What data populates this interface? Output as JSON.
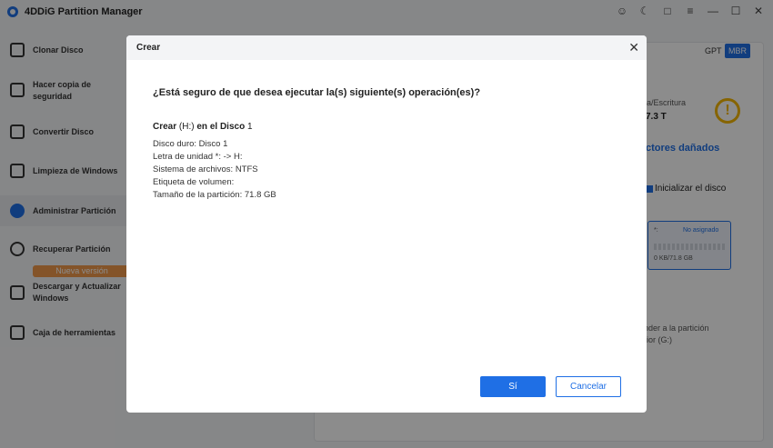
{
  "app": {
    "title": "4DDiG Partition Manager"
  },
  "window_icons": [
    "user-icon",
    "moon-icon",
    "feedback-icon",
    "menu-icon",
    "minimize-icon",
    "maximize-icon",
    "close-icon"
  ],
  "sidebar": {
    "items": [
      {
        "label": "Clonar Disco",
        "icon": "clone-disk-icon"
      },
      {
        "label": "Hacer copia de seguridad",
        "icon": "backup-icon"
      },
      {
        "label": "Convertir Disco",
        "icon": "convert-disk-icon"
      },
      {
        "label": "Limpieza de Windows",
        "icon": "broom-icon"
      },
      {
        "label": "Administrar Partición",
        "icon": "pie-chart-icon",
        "active": true
      },
      {
        "label": "Recuperar Partición",
        "icon": "recover-icon"
      },
      {
        "label": "Descargar y Actualizar Windows",
        "icon": "download-icon",
        "badge": "Nueva versión"
      },
      {
        "label": "Caja de herramientas",
        "icon": "toolbox-icon"
      }
    ]
  },
  "background": {
    "gpt": "GPT",
    "mbr": "MBR",
    "rw_label": "ra/Escritura",
    "rw_value": "7.3 T",
    "sectores": "ctores dañados",
    "init_disk": "Inicializar el disco",
    "unallocated_label": "No asignado",
    "unallocated_prefix": "*:",
    "unallocated_size": "0 KB/71.8 GB",
    "extend_line1": "nder a la partición",
    "extend_line2": "rior (G:)"
  },
  "dialog": {
    "title": "Crear",
    "question": "¿Está seguro de que desea ejecutar la(s) siguiente(s) operación(es)?",
    "operation_prefix": "Crear",
    "operation_drive": "(H:)",
    "operation_mid": "en el Disco",
    "operation_disk_num": "1",
    "details": [
      "Disco duro: Disco 1",
      "Letra de unidad *: -> H:",
      "Sistema de archivos: NTFS",
      "Etiqueta de volumen:",
      "Tamaño de la partición: 71.8 GB"
    ],
    "yes_label": "Sí",
    "cancel_label": "Cancelar"
  }
}
